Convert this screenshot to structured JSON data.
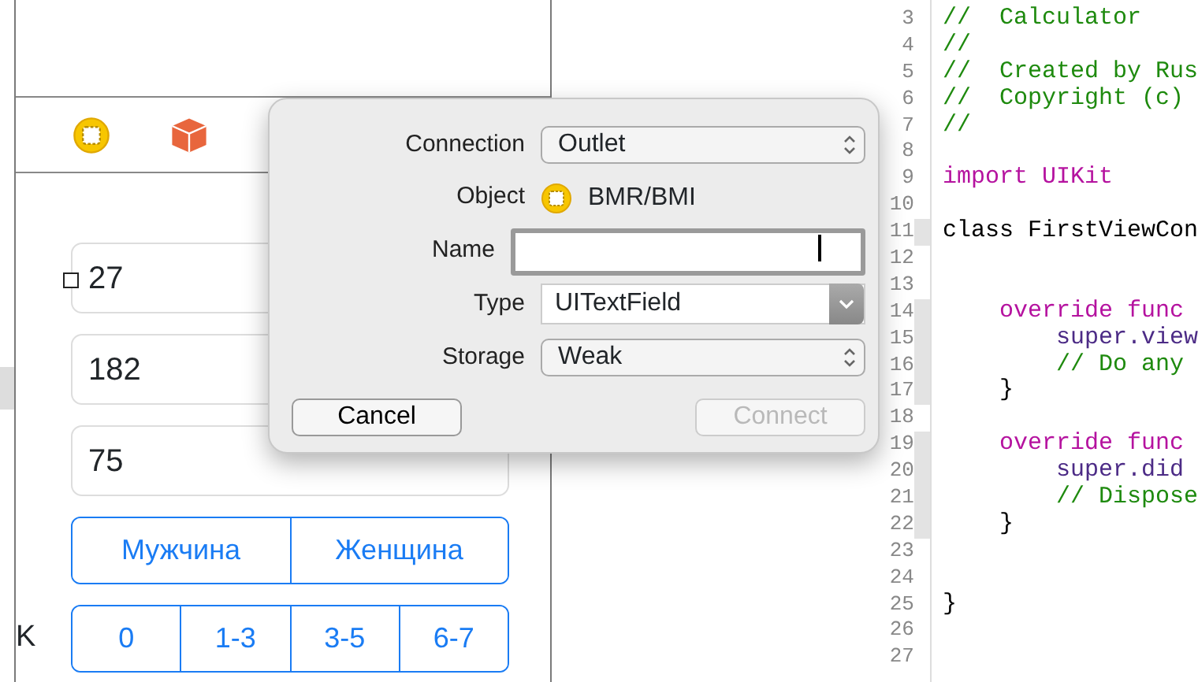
{
  "canvas": {
    "fields": [
      {
        "value": "27",
        "selected": true
      },
      {
        "value": "182",
        "selected": false
      },
      {
        "value": "75",
        "selected": false
      }
    ],
    "gender_segments": [
      "Мужчина",
      "Женщина"
    ],
    "range_segments": [
      "0",
      "1-3",
      "3-5",
      "6-7"
    ],
    "side_label": "K"
  },
  "dialog": {
    "rows": [
      {
        "kind": "popup",
        "label": "Connection",
        "value": "Outlet"
      },
      {
        "kind": "object",
        "label": "Object",
        "value": "BMR/BMI"
      },
      {
        "kind": "input",
        "label": "Name",
        "value": ""
      },
      {
        "kind": "combo",
        "label": "Type",
        "value": "UITextField"
      },
      {
        "kind": "popup",
        "label": "Storage",
        "value": "Weak"
      }
    ],
    "buttons": [
      {
        "label": "Cancel",
        "disabled": false
      },
      {
        "label": "Connect",
        "disabled": true
      }
    ]
  },
  "editor": {
    "lines": [
      {
        "number": "3",
        "code": "//  Calculator",
        "kind": "comment",
        "marked": false
      },
      {
        "number": "4",
        "code": "//",
        "kind": "comment",
        "marked": false
      },
      {
        "number": "5",
        "code": "//  Created by Rus",
        "kind": "comment",
        "marked": false
      },
      {
        "number": "6",
        "code": "//  Copyright (c)",
        "kind": "comment",
        "marked": false
      },
      {
        "number": "7",
        "code": "//",
        "kind": "comment",
        "marked": false
      },
      {
        "number": "8",
        "marked": false
      },
      {
        "number": "9",
        "code": "import UIKit",
        "kind": "import",
        "marked": false
      },
      {
        "number": "10",
        "marked": false
      },
      {
        "number": "11",
        "code": "class FirstViewCon",
        "kind": "class",
        "marked": true
      },
      {
        "number": "12",
        "marked": false
      },
      {
        "number": "13",
        "marked": false
      },
      {
        "number": "14",
        "code": "    override func",
        "kind": "keyword",
        "marked": true
      },
      {
        "number": "15",
        "code": "        super.view",
        "kind": "super",
        "marked": true
      },
      {
        "number": "16",
        "code": "        // Do any",
        "kind": "comment",
        "marked": true
      },
      {
        "number": "17",
        "code": "    }",
        "kind": "plain",
        "marked": true
      },
      {
        "number": "18",
        "marked": false
      },
      {
        "number": "19",
        "code": "    override func",
        "kind": "keyword",
        "marked": true
      },
      {
        "number": "20",
        "code": "        super.did",
        "kind": "super",
        "marked": true
      },
      {
        "number": "21",
        "code": "        // Dispose",
        "kind": "comment",
        "marked": true
      },
      {
        "number": "22",
        "code": "    }",
        "kind": "plain",
        "marked": true
      },
      {
        "number": "23",
        "marked": false
      },
      {
        "number": "24",
        "marked": false
      },
      {
        "number": "25",
        "code": "}",
        "kind": "plain",
        "marked": false
      },
      {
        "number": "26",
        "marked": false
      },
      {
        "number": "27",
        "marked": false
      }
    ]
  }
}
